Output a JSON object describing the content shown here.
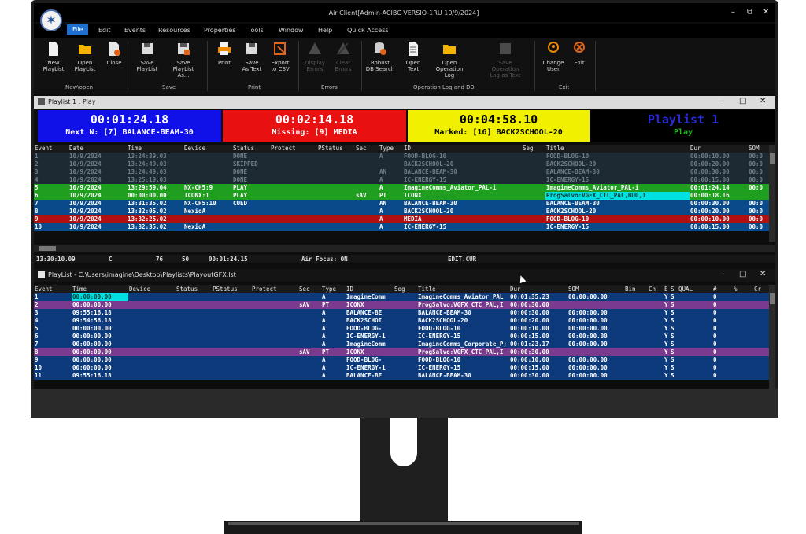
{
  "app": {
    "title": "Air Client[Admin-ACIBC-VERSIO-1RU 10/9/2024]"
  },
  "menu": [
    "File",
    "Edit",
    "Events",
    "Resources",
    "Properties",
    "Tools",
    "Window",
    "Help",
    "Quick Access"
  ],
  "ribbon": {
    "buttons": [
      {
        "label": "New\nPlayList",
        "icon": "new-playlist-icon",
        "enabled": true
      },
      {
        "label": "Open\nPlayList",
        "icon": "open-folder-icon",
        "enabled": true
      },
      {
        "label": "Close",
        "icon": "close-file-icon",
        "enabled": true
      },
      {
        "label": "Save\nPlayList",
        "icon": "save-icon",
        "enabled": true
      },
      {
        "label": "Save\nPlayList As...",
        "icon": "save-as-icon",
        "enabled": true
      },
      {
        "label": "Print",
        "icon": "printer-icon",
        "enabled": true
      },
      {
        "label": "Save\nAs Text",
        "icon": "save-text-icon",
        "enabled": true
      },
      {
        "label": "Export\nto CSV",
        "icon": "export-csv-icon",
        "enabled": true
      },
      {
        "label": "Display\nErrors",
        "icon": "display-errors-icon",
        "enabled": false
      },
      {
        "label": "Clear\nErrors",
        "icon": "clear-errors-icon",
        "enabled": false
      },
      {
        "label": "Robust\nDB Search",
        "icon": "db-search-icon",
        "enabled": true
      },
      {
        "label": "Open\nText",
        "icon": "open-text-icon",
        "enabled": true
      },
      {
        "label": "Open\nOperation Log",
        "icon": "operation-log-icon",
        "enabled": true
      },
      {
        "label": "Save Operation\nLog as Text",
        "icon": "save-log-icon",
        "enabled": false
      },
      {
        "label": "Change\nUser",
        "icon": "change-user-icon",
        "enabled": true
      },
      {
        "label": "Exit",
        "icon": "exit-icon",
        "enabled": true
      }
    ],
    "groups": [
      "New\\open",
      "Save",
      "Print",
      "Errors",
      "Operation Log and DB",
      "Exit"
    ]
  },
  "playlist1": {
    "header": "Playlist 1 : Play",
    "status": [
      {
        "time": "00:01:24.18",
        "label": "Next N: [7] BALANCE-BEAM-30",
        "bg": "#1010e8",
        "fg": "#ffffff"
      },
      {
        "time": "00:02:14.18",
        "label": "Missing: [9] MEDIA",
        "bg": "#e81010",
        "fg": "#ffffff"
      },
      {
        "time": "00:04:58.10",
        "label": "Marked: [16] BACK2SCHOOL-20",
        "bg": "#f0f000",
        "fg": "#000000"
      },
      {
        "time": "Playlist 1",
        "label": "Play",
        "bg": "#000000",
        "fg": "#2a2ad8",
        "fg2": "#1fb81f"
      }
    ],
    "columns": [
      "Event",
      "Date",
      "Time",
      "Device",
      "Status",
      "Protect",
      "PStatus",
      "Sec",
      "Type",
      "ID",
      "Seg",
      "Title",
      "Dur",
      "SOM"
    ],
    "rows": [
      {
        "cells": [
          "1",
          "10/9/2024",
          "13:24:39.03",
          "",
          "DONE",
          "",
          "",
          "",
          "A",
          "FOOD-BLOG-10",
          "",
          "FOOD-BLOG-10",
          "00:00:10.00",
          "00:0"
        ],
        "style": "done"
      },
      {
        "cells": [
          "2",
          "10/9/2024",
          "13:24:49.03",
          "",
          "SKIPPED",
          "",
          "",
          "",
          "",
          "BACK2SCHOOL-20",
          "",
          "BACK2SCHOOL-20",
          "00:00:20.00",
          "00:0"
        ],
        "style": "done"
      },
      {
        "cells": [
          "3",
          "10/9/2024",
          "13:24:49.03",
          "",
          "DONE",
          "",
          "",
          "",
          "AN",
          "BALANCE-BEAM-30",
          "",
          "BALANCE-BEAM-30",
          "00:00:30.00",
          "00:0"
        ],
        "style": "done"
      },
      {
        "cells": [
          "4",
          "10/9/2024",
          "13:25:19.03",
          "",
          "DONE",
          "",
          "",
          "",
          "A",
          "IC-ENERGY-15",
          "",
          "IC-ENERGY-15",
          "00:00:15.00",
          "00:0"
        ],
        "style": "done"
      },
      {
        "cells": [
          "5",
          "10/9/2024",
          "13:29:59.04",
          "NX-CH5:9",
          "PLAY",
          "",
          "",
          "",
          "A",
          "ImagineComms_Aviator_PAL-i",
          "",
          "ImagineComms_Aviator_PAL-i",
          "00:01:24.14",
          "00:0"
        ],
        "style": "play"
      },
      {
        "cells": [
          "6",
          "10/9/2024",
          "00:00:00.00",
          "ICONX:1",
          "PLAY",
          "",
          "",
          "sAV",
          "PT",
          "ICONX",
          "",
          "ProgSalvo:VGFX_CTC_PAL,BUG,1",
          "00:00:18.16",
          ""
        ],
        "style": "play2"
      },
      {
        "cells": [
          "7",
          "10/9/2024",
          "13:31:35.02",
          "NX-CH5:10",
          "CUED",
          "",
          "",
          "",
          "AN",
          "BALANCE-BEAM-30",
          "",
          "BALANCE-BEAM-30",
          "00:00:30.00",
          "00:0"
        ],
        "style": "cued"
      },
      {
        "cells": [
          "8",
          "10/9/2024",
          "13:32:05.02",
          "NexioA",
          "",
          "",
          "",
          "",
          "A",
          "BACK2SCHOOL-20",
          "",
          "BACK2SCHOOL-20",
          "00:00:20.00",
          "00:0"
        ],
        "style": "norm"
      },
      {
        "cells": [
          "9",
          "10/9/2024",
          "13:32:25.02",
          "",
          "",
          "",
          "",
          "",
          "A",
          "MEDIA",
          "",
          "FOOD-BLOG-10",
          "00:00:10.00",
          "00:0"
        ],
        "style": "missing"
      },
      {
        "cells": [
          "10",
          "10/9/2024",
          "13:32:35.02",
          "NexioA",
          "",
          "",
          "",
          "",
          "A",
          "IC-ENERGY-15",
          "",
          "IC-ENERGY-15",
          "00:00:15.00",
          "00:0"
        ],
        "style": "norm"
      }
    ],
    "statusbar": {
      "time": "13:30:10.09",
      "mode": "C",
      "count1": "76",
      "count2": "50",
      "dur": "00:01:24.15",
      "focus": "Air Focus: ON",
      "file": "EDIT.CUR"
    }
  },
  "playlist2": {
    "header": "PlayList - C:\\Users\\imagine\\Desktop\\Playlists\\PlayoutGFX.lst",
    "columns": [
      "Event",
      "Time",
      "Device",
      "Status",
      "PStatus",
      "Protect",
      "Sec",
      "Type",
      "ID",
      "Seg",
      "Title",
      "Dur",
      "SOM",
      "Bin",
      "Ch",
      "E",
      "S",
      "QUAL",
      "#",
      "%",
      "Cr"
    ],
    "rows": [
      {
        "cells": [
          "1",
          "00:00:00.00",
          "",
          "",
          "",
          "",
          "",
          "A",
          "ImagineComm",
          "",
          "ImagineComms_Aviator_PAL",
          "00:01:35.23",
          "00:00:00.00",
          "",
          "",
          "Y",
          "S",
          "",
          "0",
          "",
          ""
        ],
        "style": "n1"
      },
      {
        "cells": [
          "2",
          "00:00:00.00",
          "",
          "",
          "",
          "",
          "sAV",
          "PT",
          "ICONX",
          "",
          "ProgSalvo:VGFX_CTC_PAL,I",
          "00:00:30.00",
          "",
          "",
          "",
          "Y",
          "S",
          "",
          "0",
          "",
          ""
        ],
        "style": "p"
      },
      {
        "cells": [
          "3",
          "09:55:16.18",
          "",
          "",
          "",
          "",
          "",
          "A",
          "BALANCE-BE",
          "",
          "BALANCE-BEAM-30",
          "00:00:30.00",
          "00:00:00.00",
          "",
          "",
          "Y",
          "S",
          "",
          "0",
          "",
          ""
        ],
        "style": "n"
      },
      {
        "cells": [
          "4",
          "09:54:56.18",
          "",
          "",
          "",
          "",
          "",
          "A",
          "BACK2SCHOI",
          "",
          "BACK2SCHOOL-20",
          "00:00:20.00",
          "00:00:00.00",
          "",
          "",
          "Y",
          "S",
          "",
          "0",
          "",
          ""
        ],
        "style": "n"
      },
      {
        "cells": [
          "5",
          "00:00:00.00",
          "",
          "",
          "",
          "",
          "",
          "A",
          "FOOD-BLOG-",
          "",
          "FOOD-BLOG-10",
          "00:00:10.00",
          "00:00:00.00",
          "",
          "",
          "Y",
          "S",
          "",
          "0",
          "",
          ""
        ],
        "style": "n"
      },
      {
        "cells": [
          "6",
          "00:00:00.00",
          "",
          "",
          "",
          "",
          "",
          "A",
          "IC-ENERGY-1",
          "",
          "IC-ENERGY-15",
          "00:00:15.00",
          "00:00:00.00",
          "",
          "",
          "Y",
          "S",
          "",
          "0",
          "",
          ""
        ],
        "style": "n"
      },
      {
        "cells": [
          "7",
          "00:00:00.00",
          "",
          "",
          "",
          "",
          "",
          "A",
          "ImagineComm",
          "",
          "ImagineComms_Corporate_P;",
          "00:01:23.17",
          "00:00:00.00",
          "",
          "",
          "Y",
          "S",
          "",
          "0",
          "",
          ""
        ],
        "style": "n"
      },
      {
        "cells": [
          "8",
          "00:00:00.00",
          "",
          "",
          "",
          "",
          "sAV",
          "PT",
          "ICONX",
          "",
          "ProgSalvo:VGFX_CTC_PAL,I",
          "00:00:30.00",
          "",
          "",
          "",
          "Y",
          "S",
          "",
          "0",
          "",
          ""
        ],
        "style": "p"
      },
      {
        "cells": [
          "9",
          "00:00:00.00",
          "",
          "",
          "",
          "",
          "",
          "A",
          "FOOD-BLOG-",
          "",
          "FOOD-BLOG-10",
          "00:00:10.00",
          "00:00:00.00",
          "",
          "",
          "Y",
          "S",
          "",
          "0",
          "",
          ""
        ],
        "style": "n"
      },
      {
        "cells": [
          "10",
          "00:00:00.00",
          "",
          "",
          "",
          "",
          "",
          "A",
          "IC-ENERGY-1",
          "",
          "IC-ENERGY-15",
          "00:00:15.00",
          "00:00:00.00",
          "",
          "",
          "Y",
          "S",
          "",
          "0",
          "",
          ""
        ],
        "style": "n"
      },
      {
        "cells": [
          "11",
          "09:55:16.18",
          "",
          "",
          "",
          "",
          "",
          "A",
          "BALANCE-BE",
          "",
          "BALANCE-BEAM-30",
          "00:00:30.00",
          "00:00:00.00",
          "",
          "",
          "Y",
          "S",
          "",
          "0",
          "",
          ""
        ],
        "style": "n"
      }
    ]
  },
  "colors": {
    "accent": "#1f6fd1",
    "play": "#1f9e1f",
    "cued": "#0b4a8a",
    "missing": "#b01010",
    "done": "#1e2a33",
    "highlight": "#00e0e0",
    "salvo": "#7a3b8f"
  }
}
